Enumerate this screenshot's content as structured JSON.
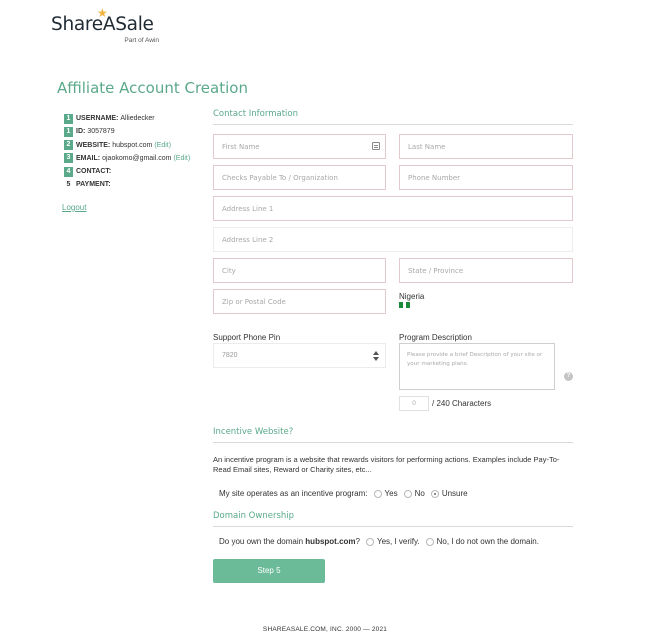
{
  "logo": {
    "name": "ShareASale",
    "sub": "Part of Awin"
  },
  "page_title": "Affiliate Account Creation",
  "steps": [
    {
      "num": "1",
      "key": "USERNAME:",
      "value": "Alliedecker",
      "edit": ""
    },
    {
      "num": "1",
      "key": "ID:",
      "value": "3057879",
      "edit": ""
    },
    {
      "num": "2",
      "key": "WEBSITE:",
      "value": "hubspot.com",
      "edit": "(Edit)"
    },
    {
      "num": "3",
      "key": "EMAIL:",
      "value": "ojaokomo@gmail.com",
      "edit": "(Edit)"
    },
    {
      "num": "4",
      "key": "CONTACT:",
      "value": "",
      "edit": ""
    },
    {
      "num": "5",
      "key": "PAYMENT:",
      "value": "",
      "edit": ""
    }
  ],
  "logout": "Logout",
  "contact": {
    "title": "Contact Information",
    "first_name": "First Name",
    "last_name": "Last Name",
    "checks_payable": "Checks Payable To / Organization",
    "phone": "Phone Number",
    "address1": "Address Line 1",
    "address2": "Address Line 2",
    "city": "City",
    "state": "State / Province",
    "zip": "Zip or Postal Code",
    "country": "Nigeria"
  },
  "support_pin": {
    "label": "Support Phone Pin",
    "value": "7820"
  },
  "program_description": {
    "label": "Program Description",
    "placeholder": "Please provide a brief Description of your site or your marketing plans.",
    "count": "0",
    "count_suffix": "/ 240 Characters",
    "help": "?"
  },
  "incentive": {
    "title": "Incentive Website?",
    "text": "An incentive program is a website that rewards visitors for performing actions. Examples include Pay-To-Read Email sites, Reward or Charity sites, etc...",
    "question": "My site operates as an incentive program:",
    "options": [
      "Yes",
      "No",
      "Unsure"
    ],
    "selected": "Unsure"
  },
  "domain": {
    "title": "Domain Ownership",
    "question_pre": "Do you own the domain",
    "domain": "hubspot.com",
    "question_post": "?",
    "options": [
      "Yes, I verify.",
      "No, I do not own the domain."
    ]
  },
  "submit": "Step 5",
  "footer": "SHAREASALE.COM, INC. 2000 — 2021",
  "colors": {
    "accent": "#5aa98a",
    "button": "#6bbb98",
    "flag_green": "#1a8a3a"
  }
}
